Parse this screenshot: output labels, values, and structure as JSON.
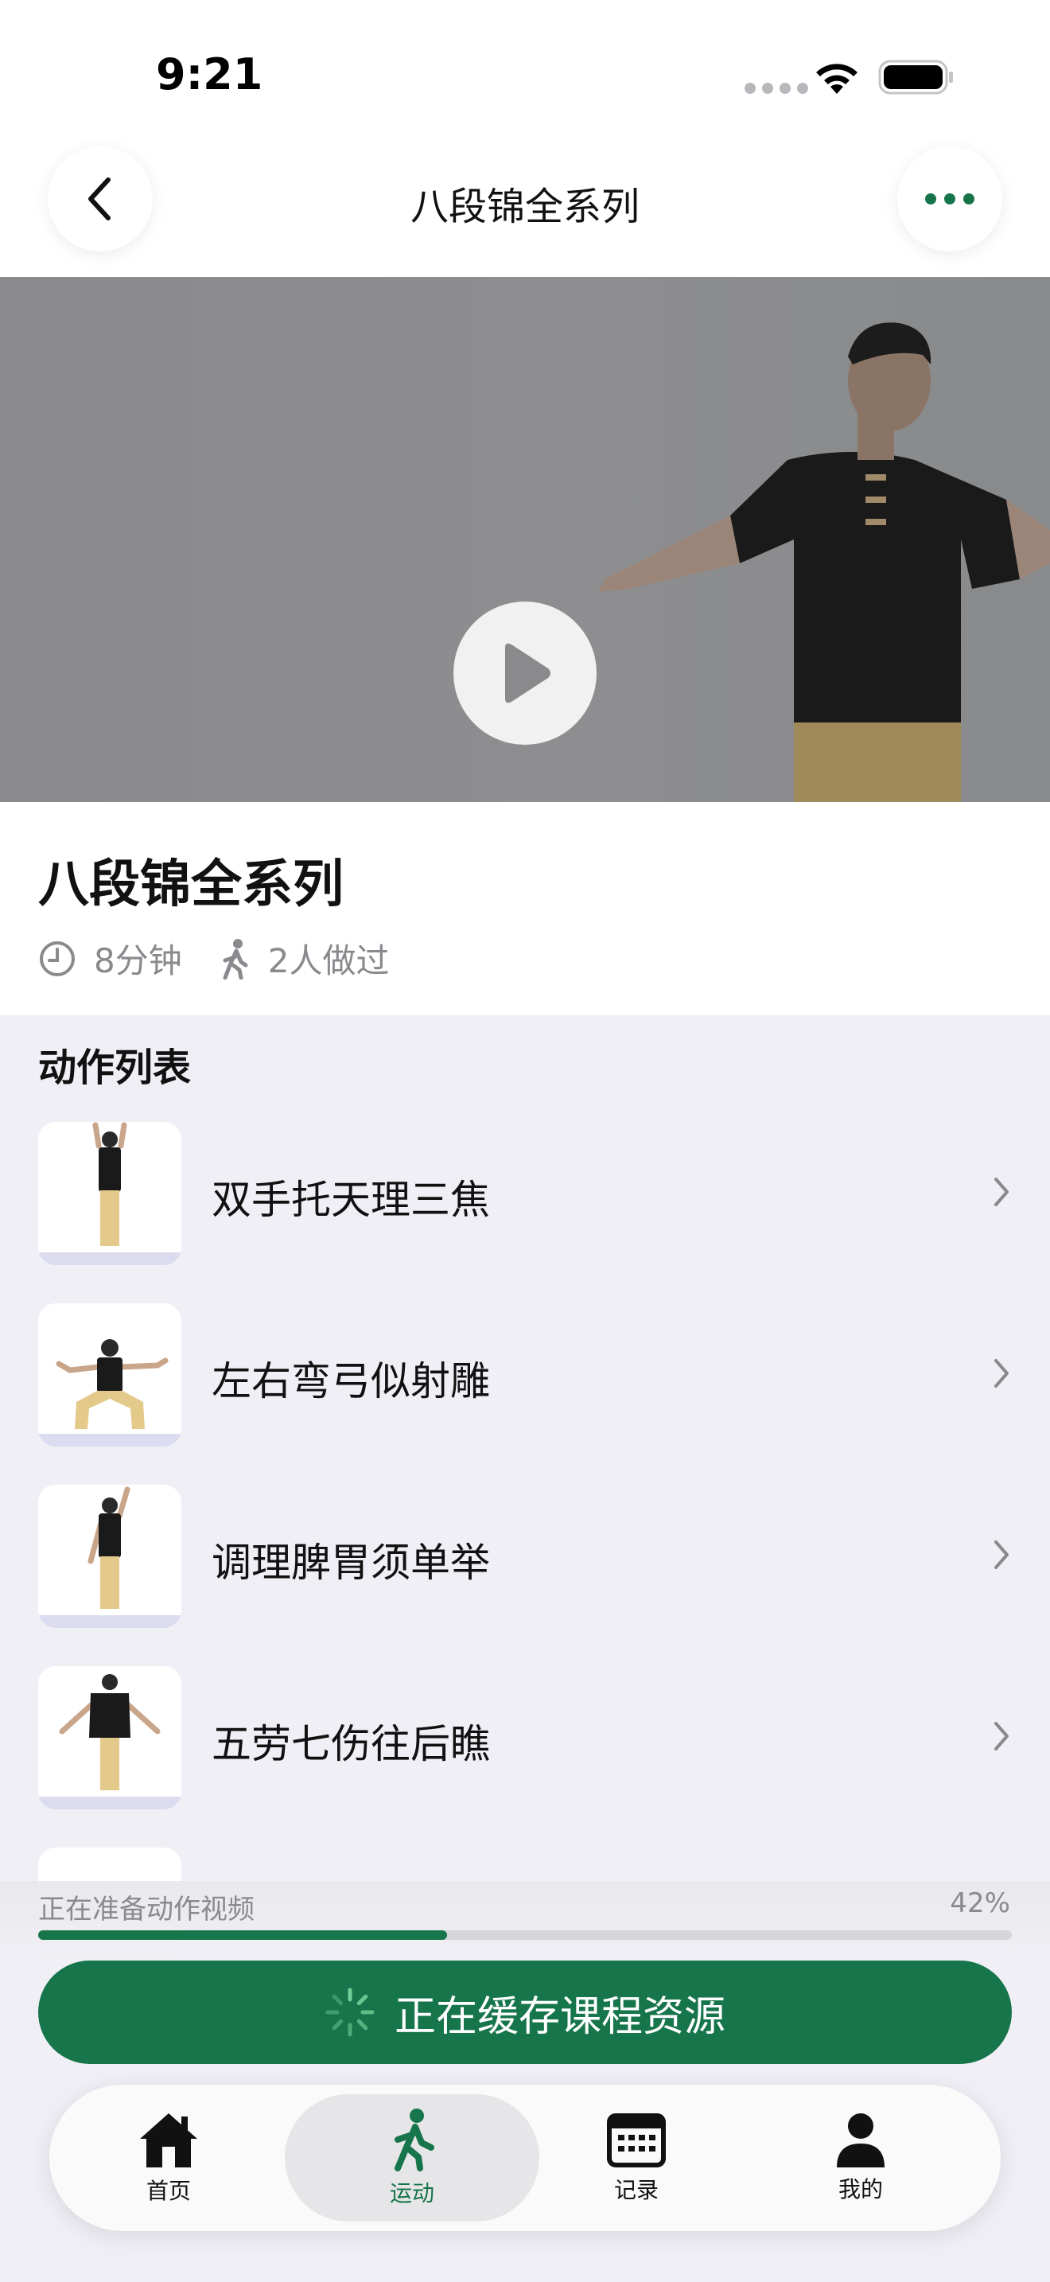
{
  "status_bar": {
    "time": "9:21"
  },
  "header": {
    "title": "八段锦全系列"
  },
  "course": {
    "title": "八段锦全系列",
    "duration": "8分钟",
    "participants": "2人做过"
  },
  "actions": {
    "section_title": "动作列表",
    "items": [
      {
        "label": "双手托天理三焦",
        "pose": "arms-up"
      },
      {
        "label": "左右弯弓似射雕",
        "pose": "bow"
      },
      {
        "label": "调理脾胃须单举",
        "pose": "one-arm-up"
      },
      {
        "label": "五劳七伤往后瞧",
        "pose": "arms-out"
      }
    ]
  },
  "progress": {
    "label": "正在准备动作视频",
    "percent_text": "42%",
    "value": 0.42
  },
  "cache_button": {
    "label": "正在缓存课程资源"
  },
  "tabbar": {
    "tabs": [
      {
        "label": "首页",
        "icon": "home-icon"
      },
      {
        "label": "运动",
        "icon": "walk-icon",
        "active": true
      },
      {
        "label": "记录",
        "icon": "calendar-icon"
      },
      {
        "label": "我的",
        "icon": "person-icon"
      }
    ]
  },
  "colors": {
    "accent": "#16754b",
    "background": "#f0eff5"
  }
}
